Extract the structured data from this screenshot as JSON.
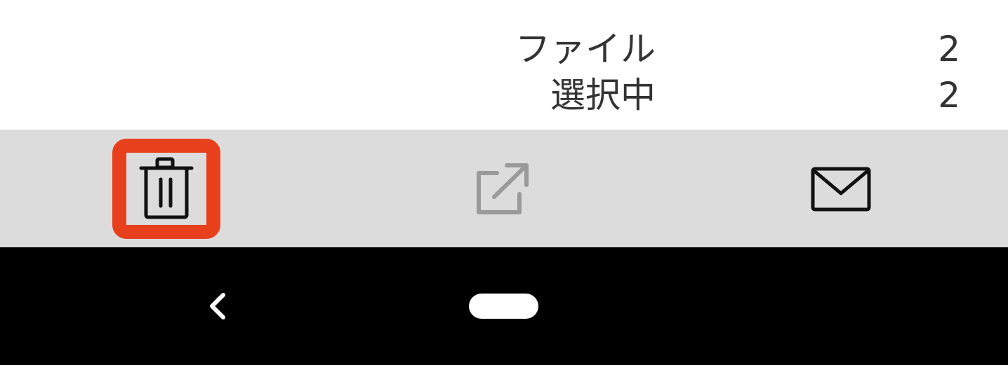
{
  "summary": {
    "files_label": "ファイル",
    "files_count": "2",
    "selected_label": "選択中",
    "selected_count": "2"
  },
  "toolbar": {
    "highlight_color": "#e8401c",
    "background_color": "#dcdcdc",
    "buttons": [
      {
        "icon": "trash-icon",
        "enabled": true,
        "highlighted": true
      },
      {
        "icon": "share-external-icon",
        "enabled": false,
        "highlighted": false
      },
      {
        "icon": "mail-icon",
        "enabled": true,
        "highlighted": false
      }
    ]
  },
  "navbar": {
    "back_icon": "back-chevron-icon",
    "home_icon": "home-pill"
  }
}
